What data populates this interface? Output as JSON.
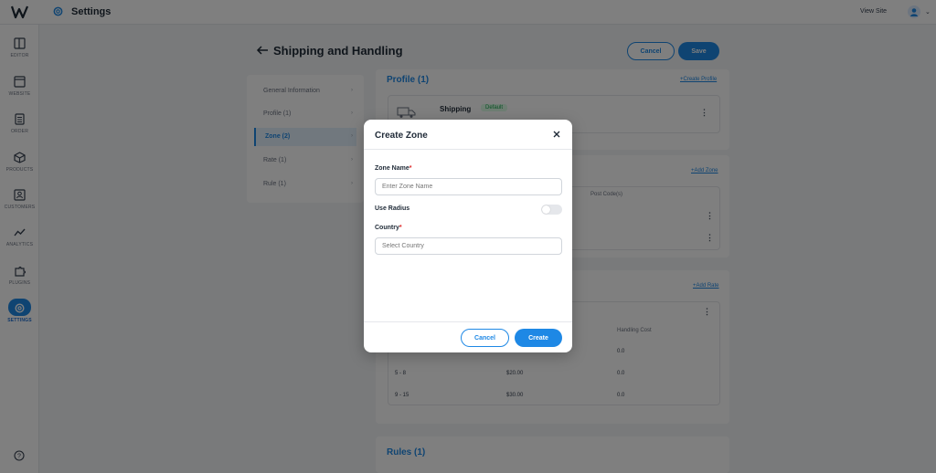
{
  "topbar": {
    "title": "Settings",
    "view_site": "View Site"
  },
  "sidebar": {
    "items": [
      {
        "label": "EDITOR",
        "icon": "editor-icon"
      },
      {
        "label": "WEBSITE",
        "icon": "website-icon"
      },
      {
        "label": "ORDER",
        "icon": "order-icon"
      },
      {
        "label": "PRODUCTS",
        "icon": "products-icon"
      },
      {
        "label": "CUSTOMERS",
        "icon": "customers-icon"
      },
      {
        "label": "ANALYTICS",
        "icon": "analytics-icon"
      },
      {
        "label": "PLUGINS",
        "icon": "plugins-icon"
      },
      {
        "label": "SETTINGS",
        "icon": "settings-icon",
        "active": true
      }
    ]
  },
  "page": {
    "title": "Shipping and Handling",
    "cancel_label": "Cancel",
    "save_label": "Save"
  },
  "left_nav": {
    "items": [
      {
        "label": "General Information"
      },
      {
        "label": "Profile (1)"
      },
      {
        "label": "Zone (2)",
        "active": true
      },
      {
        "label": "Rate (1)"
      },
      {
        "label": "Rule (1)"
      }
    ]
  },
  "profile_section": {
    "title": "Profile (1)",
    "create_link": "+Create Profile",
    "shipping_name": "Shipping",
    "badge": "Default"
  },
  "zone_section": {
    "add_link": "+Add Zone",
    "col_postcode": "Post Code(s)"
  },
  "rate_section": {
    "add_link": "+Add Rate",
    "col_handling": "Handling Cost",
    "rows": [
      {
        "range": "5 - 8",
        "price": "$20.00",
        "handling": "0.0"
      },
      {
        "range": "9 - 15",
        "price": "$30.00",
        "handling": "0.0"
      }
    ],
    "partial_handling": "0.0"
  },
  "rules_section": {
    "title": "Rules (1)"
  },
  "modal": {
    "title": "Create Zone",
    "zone_name_label": "Zone Name",
    "zone_name_placeholder": "Enter Zone Name",
    "use_radius_label": "Use Radius",
    "use_radius_on": false,
    "country_label": "Country",
    "country_placeholder": "Select Country",
    "required_mark": "*",
    "cancel_label": "Cancel",
    "create_label": "Create"
  },
  "colors": {
    "accent": "#1e88e5",
    "success": "#16a34a",
    "required": "#dc2626"
  }
}
